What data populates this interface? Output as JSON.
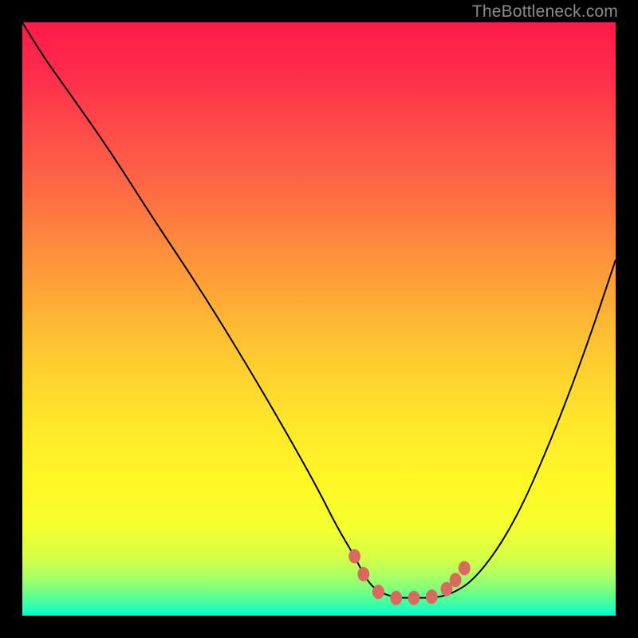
{
  "watermark": "TheBottleneck.com",
  "chart_data": {
    "type": "line",
    "title": "",
    "xlabel": "",
    "ylabel": "",
    "xlim": [
      0,
      100
    ],
    "ylim": [
      0,
      100
    ],
    "series": [
      {
        "name": "bottleneck-curve",
        "x": [
          0,
          3,
          8,
          15,
          22,
          30,
          38,
          45,
          50,
          53,
          56,
          58,
          60,
          63,
          66,
          70,
          73,
          76,
          80,
          84,
          88,
          92,
          96,
          100
        ],
        "y": [
          100,
          95,
          88,
          78,
          67,
          55,
          42,
          30,
          21,
          15,
          10,
          6,
          4,
          3,
          3,
          3,
          4,
          6,
          11,
          18,
          27,
          37,
          48,
          60
        ]
      }
    ],
    "markers": {
      "name": "optimal-range-dots",
      "color": "#d96a5f",
      "points": [
        {
          "x": 56,
          "y": 10
        },
        {
          "x": 57.5,
          "y": 7
        },
        {
          "x": 60,
          "y": 4
        },
        {
          "x": 63,
          "y": 3
        },
        {
          "x": 66,
          "y": 3
        },
        {
          "x": 69,
          "y": 3.2
        },
        {
          "x": 71.5,
          "y": 4.5
        },
        {
          "x": 73,
          "y": 6
        },
        {
          "x": 74.5,
          "y": 8
        }
      ]
    },
    "gradient_stops": [
      {
        "offset": 0,
        "color": "#ff1a4a"
      },
      {
        "offset": 0.08,
        "color": "#ff2b4b"
      },
      {
        "offset": 0.18,
        "color": "#ff4a4a"
      },
      {
        "offset": 0.3,
        "color": "#ff7043"
      },
      {
        "offset": 0.42,
        "color": "#ff9a3a"
      },
      {
        "offset": 0.55,
        "color": "#ffc631"
      },
      {
        "offset": 0.68,
        "color": "#ffe82a"
      },
      {
        "offset": 0.78,
        "color": "#fff826"
      },
      {
        "offset": 0.85,
        "color": "#f5ff2e"
      },
      {
        "offset": 0.9,
        "color": "#d8ff45"
      },
      {
        "offset": 0.93,
        "color": "#b0ff62"
      },
      {
        "offset": 0.955,
        "color": "#80ff7f"
      },
      {
        "offset": 0.975,
        "color": "#4aff9d"
      },
      {
        "offset": 0.99,
        "color": "#1effbc"
      },
      {
        "offset": 1.0,
        "color": "#00ffcc"
      }
    ]
  }
}
